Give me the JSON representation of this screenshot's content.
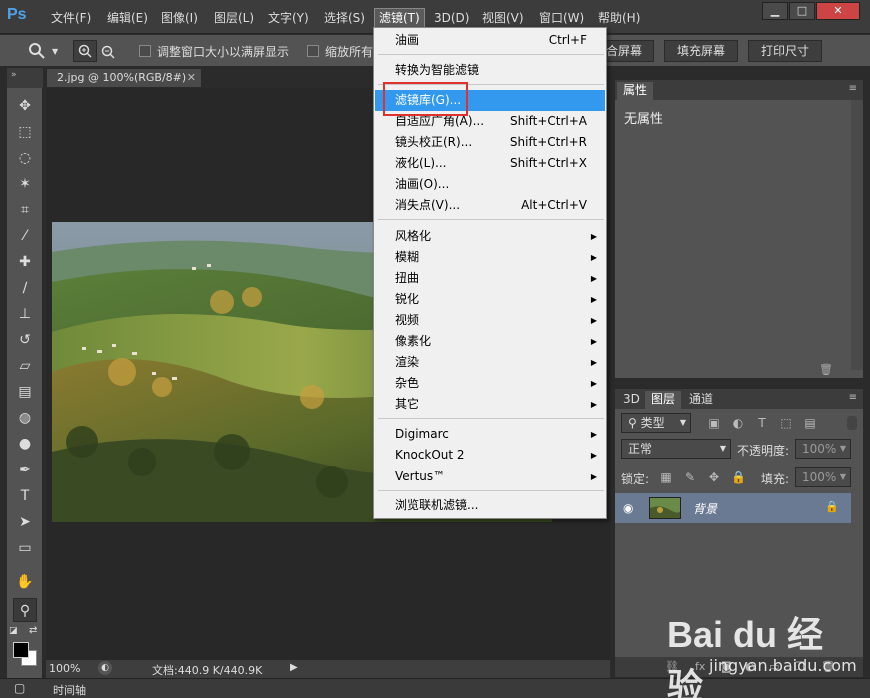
{
  "app": {
    "logo": "Ps"
  },
  "menubar": {
    "items": [
      "文件(F)",
      "编辑(E)",
      "图像(I)",
      "图层(L)",
      "文字(Y)",
      "选择(S)",
      "滤镜(T)",
      "3D(D)",
      "视图(V)",
      "窗口(W)",
      "帮助(H)"
    ],
    "active": "滤镜(T)",
    "window_buttons": {
      "minimize": "▁",
      "restore": "□",
      "close": "✕"
    }
  },
  "options_bar": {
    "resize_label": "调整窗口大小以满屏显示",
    "zoom_all_label": "缩放所有窗口",
    "fit_button": "合屏幕",
    "fill_button": "填充屏幕",
    "print_button": "打印尺寸"
  },
  "document": {
    "tab_title": "2.jpg @ 100%(RGB/8#)",
    "close": "✕",
    "zoom": "100%",
    "doc_info": "文档:440.9 K/440.9K"
  },
  "timeline": {
    "label": "时间轴"
  },
  "filter_menu": {
    "items": [
      {
        "label": "油画",
        "shortcut": "Ctrl+F"
      },
      {
        "label": "转换为智能滤镜"
      },
      {
        "label": "滤镜库(G)...",
        "highlighted": true
      },
      {
        "label": "自适应广角(A)...",
        "shortcut": "Shift+Ctrl+A"
      },
      {
        "label": "镜头校正(R)...",
        "shortcut": "Shift+Ctrl+R"
      },
      {
        "label": "液化(L)...",
        "shortcut": "Shift+Ctrl+X"
      },
      {
        "label": "油画(O)..."
      },
      {
        "label": "消失点(V)...",
        "shortcut": "Alt+Ctrl+V"
      },
      {
        "label": "风格化"
      },
      {
        "label": "模糊"
      },
      {
        "label": "扭曲"
      },
      {
        "label": "锐化"
      },
      {
        "label": "视频"
      },
      {
        "label": "像素化"
      },
      {
        "label": "渲染"
      },
      {
        "label": "杂色"
      },
      {
        "label": "其它"
      },
      {
        "label": "Digimarc"
      },
      {
        "label": "KnockOut 2"
      },
      {
        "label": "Vertus™"
      },
      {
        "label": "浏览联机滤镜..."
      }
    ]
  },
  "properties_panel": {
    "tab": "属性",
    "empty_text": "无属性"
  },
  "layers_panel": {
    "tabs": [
      "3D",
      "图层",
      "通道"
    ],
    "active_tab": "图层",
    "filter_kind": "类型",
    "blend_mode": "正常",
    "opacity_label": "不透明度:",
    "opacity_value": "100%",
    "lock_label": "锁定:",
    "fill_label": "填充:",
    "fill_value": "100%",
    "layer_name": "背景"
  },
  "watermark": {
    "brand": "Bai du 经验",
    "url": "jingyan.baidu.com"
  },
  "colors": {
    "highlight": "#3399ee",
    "annotation": "#e03030",
    "layer_selected": "#6b7a93"
  }
}
